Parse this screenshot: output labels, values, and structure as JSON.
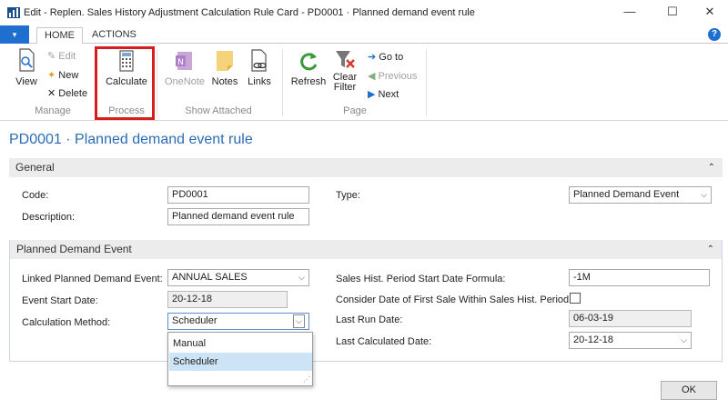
{
  "window": {
    "title": "Edit - Replen. Sales History Adjustment Calculation Rule Card - PD0001 · Planned demand event rule",
    "minimize": "—",
    "maximize": "☐",
    "close": "✕"
  },
  "ribbon_tabs": {
    "file": "▾",
    "home": "HOME",
    "actions": "ACTIONS",
    "help": "?"
  },
  "ribbon": {
    "view": "View",
    "edit": "Edit",
    "new": "New",
    "delete": "Delete",
    "manage_group": "Manage",
    "calculate": "Calculate",
    "process_group": "Process",
    "onenote": "OneNote",
    "notes": "Notes",
    "links": "Links",
    "show_attached_group": "Show Attached",
    "refresh": "Refresh",
    "clear_filter_line1": "Clear",
    "clear_filter_line2": "Filter",
    "goto": "Go to",
    "previous": "Previous",
    "next": "Next",
    "page_group": "Page"
  },
  "page_title": "PD0001 · Planned demand event rule",
  "general": {
    "header": "General",
    "code_label": "Code:",
    "code_value": "PD0001",
    "description_label": "Description:",
    "description_value": "Planned demand event rule",
    "type_label": "Type:",
    "type_value": "Planned Demand Event"
  },
  "planned": {
    "header": "Planned Demand Event",
    "linked_label": "Linked Planned Demand Event:",
    "linked_value": "ANNUAL SALES",
    "event_start_label": "Event Start Date:",
    "event_start_value": "20-12-18",
    "calc_method_label": "Calculation Method:",
    "calc_method_value": "Scheduler",
    "period_formula_label": "Sales Hist. Period Start Date Formula:",
    "period_formula_value": "-1M",
    "consider_label": "Consider Date of First Sale Within Sales Hist. Period:",
    "last_run_label": "Last Run Date:",
    "last_run_value": "06-03-19",
    "last_calc_label": "Last Calculated Date:",
    "last_calc_value": "20-12-18"
  },
  "dropdown_options": [
    "Manual",
    "Scheduler"
  ],
  "ok": "OK",
  "colors": {
    "accent": "#1f6fd0",
    "title": "#2b6db5",
    "highlight": "#d81d1d"
  }
}
